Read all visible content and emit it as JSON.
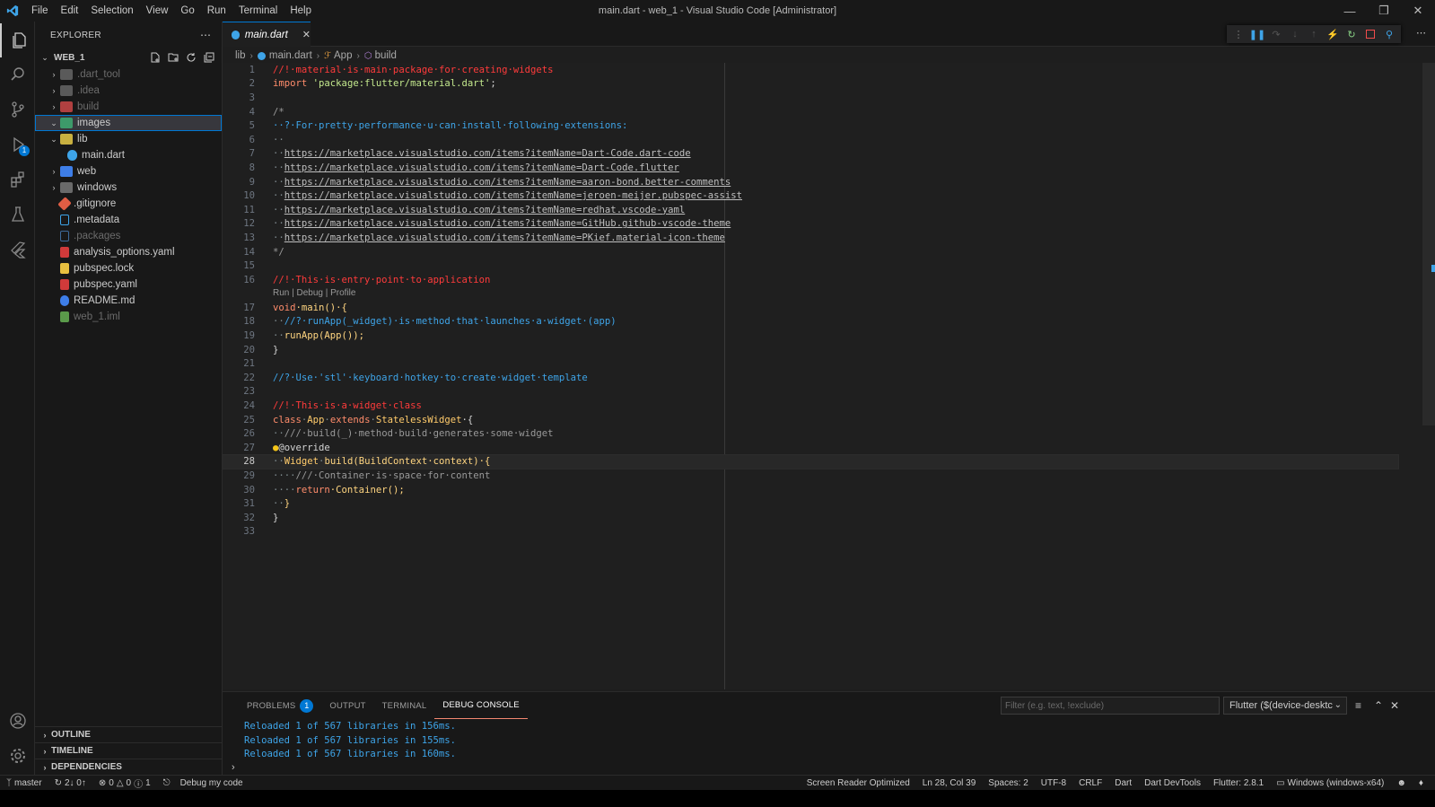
{
  "window": {
    "title": "main.dart - web_1 - Visual Studio Code [Administrator]",
    "menu": [
      "File",
      "Edit",
      "Selection",
      "View",
      "Go",
      "Run",
      "Terminal",
      "Help"
    ]
  },
  "activity_bar": {
    "run_debug_badge": "1"
  },
  "sidebar": {
    "title": "EXPLORER",
    "workspace": "WEB_1",
    "tree": [
      {
        "label": ".dart_tool",
        "type": "folder",
        "dim": true
      },
      {
        "label": ".idea",
        "type": "folder",
        "dim": true
      },
      {
        "label": "build",
        "type": "folder",
        "dim": true
      },
      {
        "label": "images",
        "type": "folder",
        "selected": true
      },
      {
        "label": "lib",
        "type": "folder",
        "expanded": true
      },
      {
        "label": "main.dart",
        "type": "file"
      },
      {
        "label": "web",
        "type": "folder"
      },
      {
        "label": "windows",
        "type": "folder"
      },
      {
        "label": ".gitignore",
        "type": "file"
      },
      {
        "label": ".metadata",
        "type": "file"
      },
      {
        "label": ".packages",
        "type": "file",
        "dim": true
      },
      {
        "label": "analysis_options.yaml",
        "type": "file"
      },
      {
        "label": "pubspec.lock",
        "type": "file"
      },
      {
        "label": "pubspec.yaml",
        "type": "file"
      },
      {
        "label": "README.md",
        "type": "file"
      },
      {
        "label": "web_1.iml",
        "type": "file",
        "dim": true
      }
    ],
    "sections": [
      "OUTLINE",
      "TIMELINE",
      "DEPENDENCIES"
    ]
  },
  "editor": {
    "tab": "main.dart",
    "breadcrumb": [
      "lib",
      "main.dart",
      "App",
      "build"
    ],
    "codelens": "Run | Debug | Profile",
    "line_numbers": [
      "1",
      "2",
      "3",
      "4",
      "5",
      "6",
      "7",
      "8",
      "9",
      "10",
      "11",
      "12",
      "13",
      "14",
      "15",
      "16",
      "17",
      "18",
      "19",
      "20",
      "21",
      "22",
      "23",
      "24",
      "25",
      "26",
      "27",
      "28",
      "29",
      "30",
      "31",
      "32",
      "33"
    ],
    "current_line": "28",
    "lines": {
      "l1": "//!·material·is·main·package·for·creating·widgets",
      "l2_kw": "import",
      "l2_str": "'package:flutter/material.dart'",
      "l2_end": ";",
      "l4": "/*",
      "l5": "··?·For·pretty·performance·u·can·install·following·extensions:",
      "l6": "··",
      "l7": "https://marketplace.visualstudio.com/items?itemName=Dart-Code.dart-code",
      "l8": "https://marketplace.visualstudio.com/items?itemName=Dart-Code.flutter",
      "l9": "https://marketplace.visualstudio.com/items?itemName=aaron-bond.better-comments",
      "l10": "https://marketplace.visualstudio.com/items?itemName=jeroen-meijer.pubspec-assist",
      "l11": "https://marketplace.visualstudio.com/items?itemName=redhat.vscode-yaml",
      "l12": "https://marketplace.visualstudio.com/items?itemName=GitHub.github-vscode-theme",
      "l13": "https://marketplace.visualstudio.com/items?itemName=PKief.material-icon-theme",
      "l14": "*/",
      "l16": "//!·This·is·entry·point·to·application",
      "l17_kw": "void",
      "l17_rest": "·main()·{",
      "l18": "//?·runApp(_widget)·is·method·that·launches·a·widget·(app)",
      "l19": "runApp(App());",
      "l20": "}",
      "l22": "//?·Use·'stl'·keyboard·hotkey·to·create·widget·template",
      "l24": "//!·This·is·a·widget·class",
      "l25_kw": "class",
      "l25_cls": "App",
      "l25_kw2": "extends",
      "l25_cls2": "StatelessWidget",
      "l25_end": "·{",
      "l26": "///·build(_)·method·build·generates·some·widget",
      "l27": "@override",
      "l28_cls": "Widget",
      "l28_fn": "build",
      "l28_rest": "(BuildContext·context)·{",
      "l29": "///·Container·is·space·for·content",
      "l30_kw": "return",
      "l30_rest": "·Container();",
      "l31": "}",
      "l32": "}"
    }
  },
  "panel": {
    "tabs": [
      "PROBLEMS",
      "OUTPUT",
      "TERMINAL",
      "DEBUG CONSOLE"
    ],
    "problems_badge": "1",
    "filter_placeholder": "Filter (e.g. text, !exclude)",
    "select_value": "Flutter ($(device-desktc",
    "console": [
      "Reloaded 1 of 567 libraries in 156ms.",
      "Reloaded 1 of 567 libraries in 155ms.",
      "Reloaded 1 of 567 libraries in 160ms."
    ]
  },
  "statusbar": {
    "branch": "master",
    "sync": "2↓ 0↑",
    "errors": "0",
    "warnings": "0",
    "infos": "1",
    "debug": "Debug my code",
    "screen_reader": "Screen Reader Optimized",
    "position": "Ln 28, Col 39",
    "spaces": "Spaces: 2",
    "encoding": "UTF-8",
    "eol": "CRLF",
    "language": "Dart",
    "devtools": "Dart DevTools",
    "flutter": "Flutter: 2.8.1",
    "device": "Windows (windows-x64)"
  },
  "colors": {
    "accent": "#0078d4",
    "comment_red": "#ff3b3b",
    "comment_blue": "#3ea4e8"
  }
}
